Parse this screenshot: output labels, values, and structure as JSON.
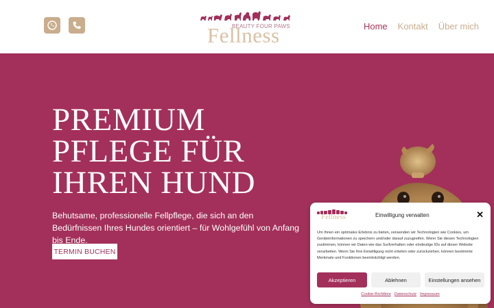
{
  "header": {
    "social": [
      {
        "icon": "whatsapp-icon"
      },
      {
        "icon": "phone-icon"
      }
    ],
    "logo": {
      "subtitle": "BEAUTY FOUR PAWS",
      "name": "Fellness"
    },
    "nav": [
      {
        "label": "Home",
        "active": true
      },
      {
        "label": "Kontakt",
        "active": false
      },
      {
        "label": "Über mich",
        "active": false
      }
    ]
  },
  "hero": {
    "title_lines": [
      "PREMIUM",
      "PFLEGE FÜR",
      "IHREN HUND"
    ],
    "text": "Behutsame, professionelle Fellpflege, die sich an den Bedürfnissen Ihres Hundes orientiert – für Wohlgefühl von Anfang bis Ende.",
    "cta_label": "TERMIN BUCHEN"
  },
  "cookie": {
    "logo_name": "Fellness",
    "title": "Einwilligung verwalten",
    "body": "Um Ihnen ein optimales Erlebnis zu bieten, verwenden wir Technologien wie Cookies, um Geräteinformationen zu speichern und/oder darauf zuzugreifen. Wenn Sie diesen Technologien zustimmen, können wir Daten wie das Surfverhalten oder eindeutige IDs auf dieser Website verarbeiten. Wenn Sie Ihre Einwilligung nicht erteilen oder zurückziehen, können bestimmte Merkmale und Funktionen beeinträchtigt werden.",
    "accept_label": "Akzeptieren",
    "deny_label": "Ablehnen",
    "settings_label": "Einstellungen ansehen",
    "links": [
      "Cookie-Richtlinie",
      "Datenschutz",
      "Impressum"
    ]
  },
  "colors": {
    "brand": "#a3305a",
    "gold": "#c9ad8c"
  }
}
